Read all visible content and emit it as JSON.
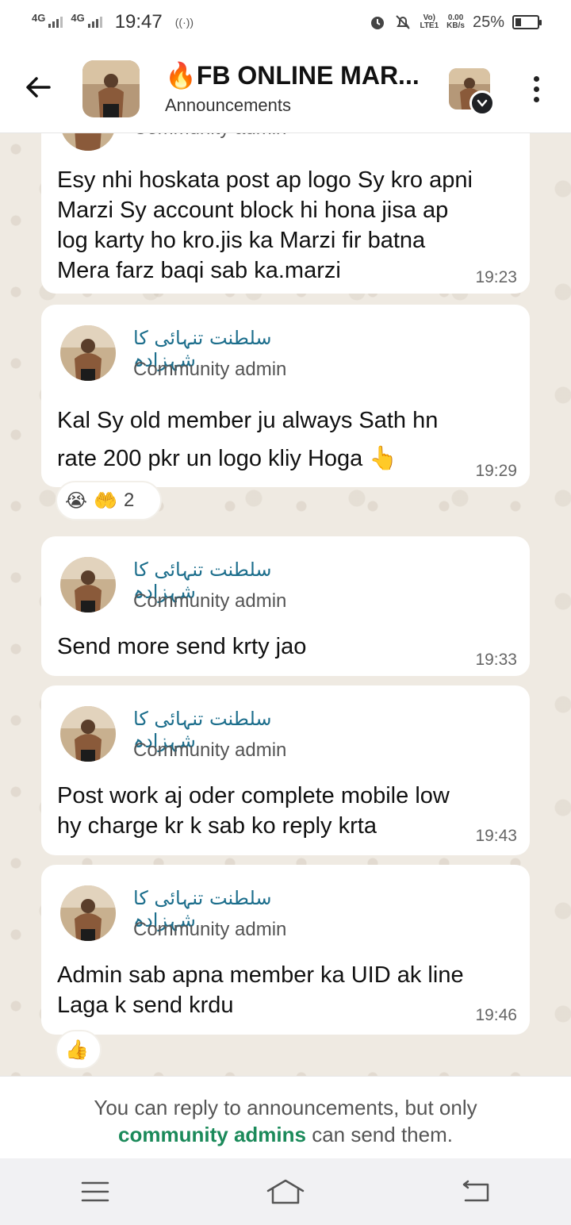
{
  "status_bar": {
    "network1": "4G",
    "network2": "4G",
    "time": "19:47",
    "volte": "Vo)",
    "lte": "LTE1",
    "speed_value": "0.00",
    "speed_unit": "KB/s",
    "battery_pct": "25%",
    "battery_level": 0.25
  },
  "header": {
    "fire_emoji": "🔥",
    "title": "FB ONLINE MAR...",
    "subtitle": "Announcements"
  },
  "messages": [
    {
      "sender_role": "Community admin",
      "text_lines": [
        "Esy nhi hoskata post ap logo Sy kro apni",
        "Marzi Sy account block hi hona jisa ap",
        "log karty ho kro.jis ka Marzi fir batna",
        "Mera farz baqi sab ka.marzi"
      ],
      "time": "19:23"
    },
    {
      "sender_name": "سلطنت تنہائی کا شہزادہ",
      "sender_role": "Community admin",
      "text_lines": [
        "Kal Sy old member ju always Sath hn",
        "rate 200 pkr un logo kliy Hoga 👆"
      ],
      "time": "19:29",
      "reactions": {
        "emojis": [
          "😭",
          "🤲"
        ],
        "count": "2"
      }
    },
    {
      "sender_name": "سلطنت تنہائی کا شہزادہ",
      "sender_role": "Community admin",
      "text_lines": [
        "Send more send krty jao"
      ],
      "time": "19:33"
    },
    {
      "sender_name": "سلطنت تنہائی کا شہزادہ",
      "sender_role": "Community admin",
      "text_lines": [
        "Post work aj oder complete mobile low",
        "hy charge kr k sab ko reply krta"
      ],
      "time": "19:43"
    },
    {
      "sender_name": "سلطنت تنہائی کا شہزادہ",
      "sender_role": "Community admin",
      "text_lines": [
        "Admin sab apna member ka UID ak line",
        "Laga k send krdu"
      ],
      "time": "19:46",
      "reactions": {
        "emojis": [
          "👍"
        ]
      }
    }
  ],
  "footer": {
    "note_before": "You can reply to announcements, but only",
    "note_link": "community admins",
    "note_after": " can send them."
  },
  "colors": {
    "accent_green": "#1b8a5a",
    "sender_blue": "#1c6e8c",
    "chat_bg": "#efeae2"
  },
  "icons": [
    "back-arrow-icon",
    "chevron-down-icon",
    "more-vert-icon",
    "alarm-icon",
    "mute-icon",
    "menu-icon",
    "home-icon",
    "back-nav-icon"
  ]
}
